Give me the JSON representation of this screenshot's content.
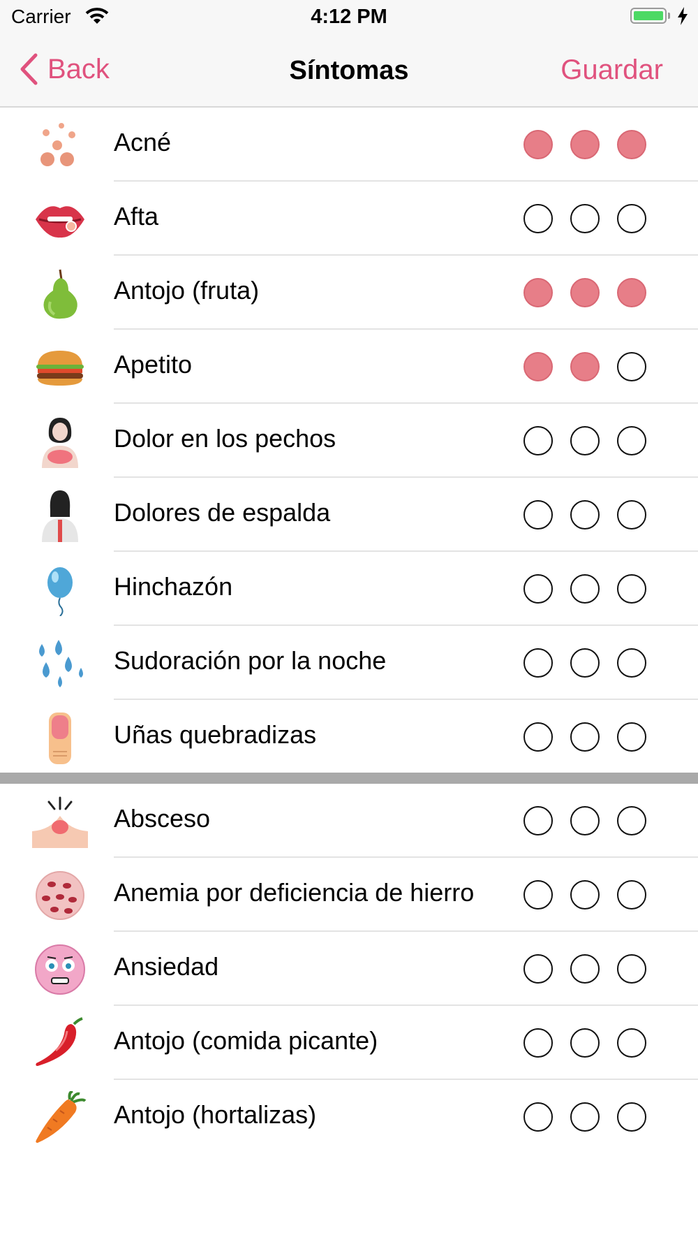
{
  "status_bar": {
    "carrier": "Carrier",
    "time": "4:12 PM"
  },
  "nav": {
    "back_label": "Back",
    "title": "Síntomas",
    "save_label": "Guardar"
  },
  "colors": {
    "accent": "#e0527e",
    "filled_dot": "#e77e88"
  },
  "section1": [
    {
      "icon": "acne-icon",
      "label": "Acné",
      "level": 3
    },
    {
      "icon": "lips-icon",
      "label": "Afta",
      "level": 0
    },
    {
      "icon": "pear-icon",
      "label": "Antojo (fruta)",
      "level": 3
    },
    {
      "icon": "burger-icon",
      "label": "Apetito",
      "level": 2
    },
    {
      "icon": "breast-pain-icon",
      "label": "Dolor en los pechos",
      "level": 0
    },
    {
      "icon": "back-pain-icon",
      "label": "Dolores de espalda",
      "level": 0
    },
    {
      "icon": "balloon-icon",
      "label": "Hinchazón",
      "level": 0
    },
    {
      "icon": "sweat-drops-icon",
      "label": "Sudoración por la noche",
      "level": 0
    },
    {
      "icon": "nail-icon",
      "label": "Uñas quebradizas",
      "level": 0
    }
  ],
  "section2": [
    {
      "icon": "abscess-icon",
      "label": "Absceso",
      "level": 0
    },
    {
      "icon": "blood-cell-icon",
      "label": "Anemia por deficiencia de hierro",
      "level": 0
    },
    {
      "icon": "anxious-face-icon",
      "label": "Ansiedad",
      "level": 0
    },
    {
      "icon": "chili-pepper-icon",
      "label": "Antojo (comida picante)",
      "level": 0
    },
    {
      "icon": "carrot-icon",
      "label": "Antojo (hortalizas)",
      "level": 0
    }
  ]
}
